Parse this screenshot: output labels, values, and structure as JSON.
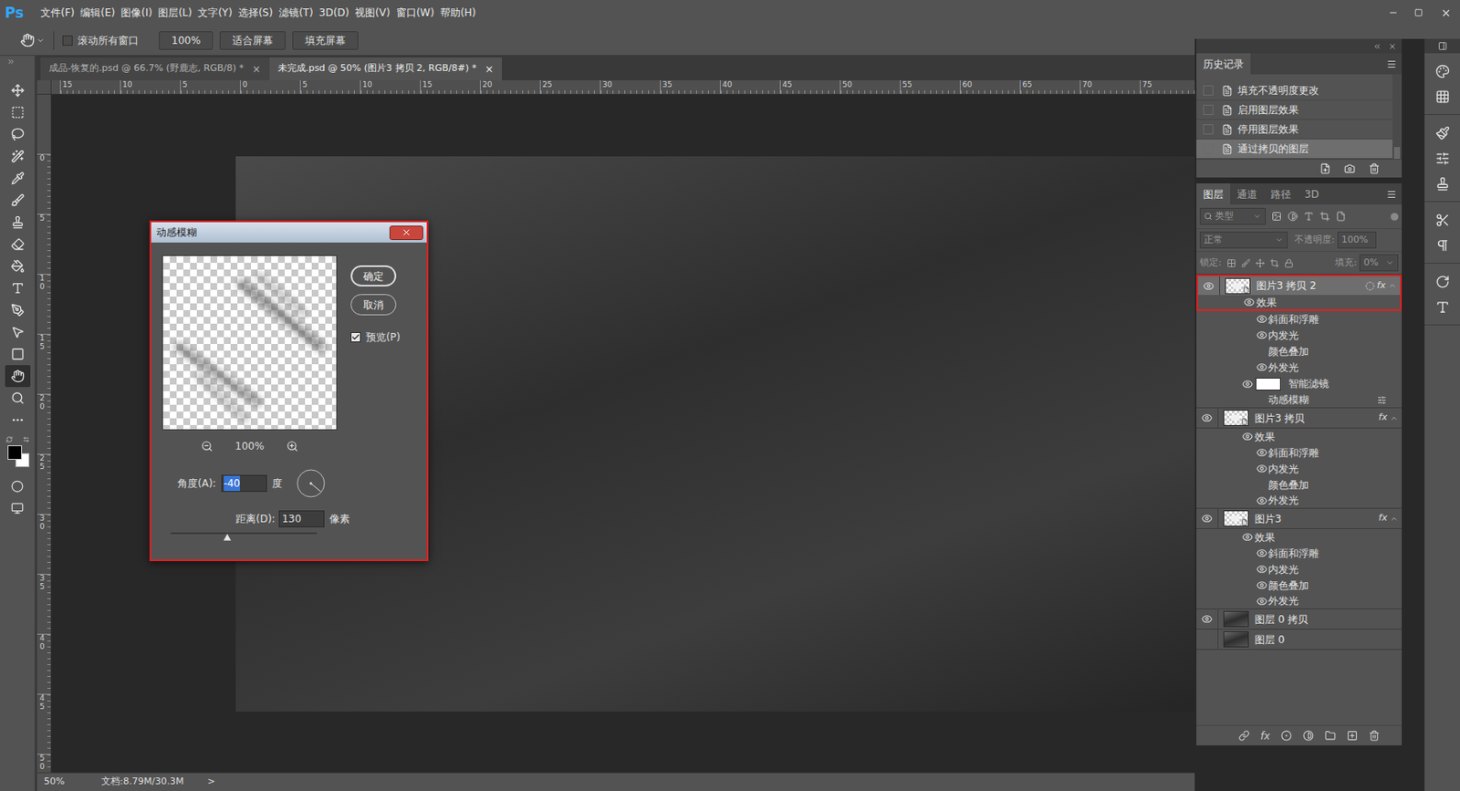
{
  "app": {
    "logo": "Ps"
  },
  "menu": [
    "文件(F)",
    "编辑(E)",
    "图像(I)",
    "图层(L)",
    "文字(Y)",
    "选择(S)",
    "滤镜(T)",
    "3D(D)",
    "视图(V)",
    "窗口(W)",
    "帮助(H)"
  ],
  "options_bar": {
    "scroll_all": {
      "label": "滚动所有窗口",
      "checked": false
    },
    "buttons": [
      "100%",
      "适合屏幕",
      "填充屏幕"
    ]
  },
  "tabs": [
    {
      "label": "成品-恢复的.psd @ 66.7% (野鹿志, RGB/8) *",
      "close": "×",
      "selected": false
    },
    {
      "label": "未完成.psd @ 50% (图片3 拷贝 2, RGB/8#) *",
      "close": "×",
      "selected": true
    }
  ],
  "rulers": {
    "top": [
      "15",
      "10",
      "5",
      "0",
      "5",
      "10",
      "15",
      "20",
      "25",
      "30",
      "35",
      "40",
      "45",
      "50",
      "55",
      "60",
      "65",
      "70",
      "75"
    ],
    "left": [
      "0",
      "5",
      "10",
      "15",
      "20",
      "25",
      "30",
      "35",
      "40",
      "45",
      "50"
    ]
  },
  "tools": {
    "items": [
      {
        "selected": false
      },
      {
        "selected": false
      },
      {
        "selected": false
      },
      {
        "selected": false
      },
      {
        "selected": false
      },
      {
        "selected": false
      },
      {
        "selected": false
      },
      {
        "selected": false
      },
      {
        "selected": false
      },
      {
        "selected": false
      },
      {
        "selected": false
      },
      {
        "selected": false
      },
      {
        "selected": false
      },
      {
        "selected": true
      },
      {
        "selected": false
      },
      {
        "selected": false
      }
    ],
    "foreground": "#000000",
    "background": "#ffffff"
  },
  "dialog": {
    "title": "动感模糊",
    "annotated": true,
    "buttons": [
      {
        "label": "确定",
        "default": true
      },
      {
        "label": "取消",
        "default": false
      }
    ],
    "preview": {
      "label": "预览(P)",
      "checked": true
    },
    "zoom": "100%",
    "angle": {
      "label": "角度(A):",
      "value": "-40",
      "unit": "度",
      "focused": true
    },
    "distance": {
      "label": "距离(D):",
      "value": "130",
      "unit": "像素",
      "level": 0.39
    }
  },
  "history": {
    "tab": "历史记录",
    "scroll": {
      "level": 1
    },
    "items": [
      {
        "label": "填充不透明度更改",
        "selected": false
      },
      {
        "label": "启用图层效果",
        "selected": false
      },
      {
        "label": "停用图层效果",
        "selected": false
      },
      {
        "label": "通过拷贝的图层",
        "selected": true
      }
    ]
  },
  "layers_panel": {
    "tabs": [
      {
        "label": "图层",
        "selected": true
      },
      {
        "label": "通道",
        "selected": false
      },
      {
        "label": "路径",
        "selected": false
      },
      {
        "label": "3D",
        "selected": false
      }
    ],
    "filter": "类型",
    "filter_toggle": {
      "on": false
    },
    "blend_mode": {
      "value": "正常",
      "disabled": true
    },
    "opacity": {
      "label": "不透明度:",
      "value": "100%",
      "disabled": true
    },
    "lock": {
      "label": "锁定:",
      "disabled": true
    },
    "fill": {
      "label": "填充:",
      "value": "0%",
      "disabled": true
    },
    "fx": "fx",
    "rows": [
      {
        "kind": "layer",
        "name": "图片3 拷贝 2",
        "visible": true,
        "selected": true,
        "fx": true,
        "expanded": true,
        "thumb": "smart",
        "smart_filters": true,
        "annotated": true
      },
      {
        "kind": "effects",
        "name": "效果",
        "visible": true,
        "selected": false,
        "annotated": true
      },
      {
        "kind": "effect",
        "name": "斜面和浮雕",
        "visible": true,
        "selected": false
      },
      {
        "kind": "effect",
        "name": "内发光",
        "visible": true,
        "selected": false
      },
      {
        "kind": "effect",
        "name": "颜色叠加",
        "visible": false,
        "selected": false
      },
      {
        "kind": "effect",
        "name": "外发光",
        "visible": true,
        "selected": false
      },
      {
        "kind": "smart-filters",
        "name": "智能滤镜",
        "visible": true,
        "selected": false
      },
      {
        "kind": "filter",
        "name": "动感模糊",
        "visible": false,
        "selected": false
      },
      {
        "kind": "layer",
        "name": "图片3 拷贝",
        "visible": true,
        "selected": false,
        "fx": true,
        "expanded": true,
        "thumb": "smart",
        "smart_filters": false
      },
      {
        "kind": "effects",
        "name": "效果",
        "visible": true,
        "selected": false
      },
      {
        "kind": "effect",
        "name": "斜面和浮雕",
        "visible": true,
        "selected": false
      },
      {
        "kind": "effect",
        "name": "内发光",
        "visible": true,
        "selected": false
      },
      {
        "kind": "effect",
        "name": "颜色叠加",
        "visible": false,
        "selected": false
      },
      {
        "kind": "effect",
        "name": "外发光",
        "visible": true,
        "selected": false
      },
      {
        "kind": "layer",
        "name": "图片3",
        "visible": true,
        "selected": false,
        "fx": true,
        "expanded": true,
        "thumb": "smart",
        "smart_filters": false
      },
      {
        "kind": "effects",
        "name": "效果",
        "visible": true,
        "selected": false
      },
      {
        "kind": "effect",
        "name": "斜面和浮雕",
        "visible": true,
        "selected": false
      },
      {
        "kind": "effect",
        "name": "内发光",
        "visible": true,
        "selected": false
      },
      {
        "kind": "effect",
        "name": "颜色叠加",
        "visible": true,
        "selected": false
      },
      {
        "kind": "effect",
        "name": "外发光",
        "visible": true,
        "selected": false
      },
      {
        "kind": "layer",
        "name": "图层 0 拷贝",
        "visible": true,
        "selected": false,
        "fx": false,
        "expanded": false,
        "thumb": "photo",
        "smart_filters": false
      },
      {
        "kind": "layer",
        "name": "图层 0",
        "visible": false,
        "selected": false,
        "fx": false,
        "expanded": false,
        "thumb": "photo",
        "smart_filters": false
      }
    ]
  },
  "status_bar": {
    "zoom": "50%",
    "doc": "文档:8.79M/30.3M",
    "arrow": ">"
  }
}
